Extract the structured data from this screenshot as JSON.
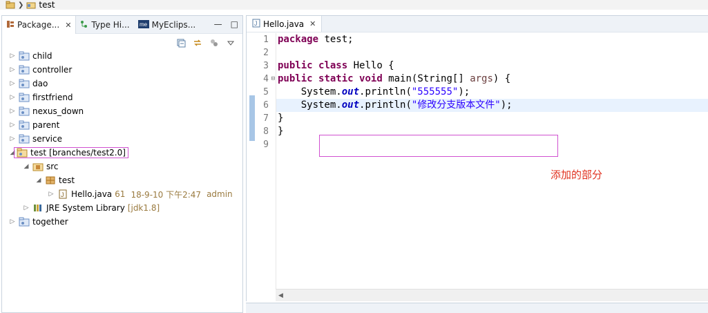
{
  "breadcrumb": {
    "project": "test"
  },
  "left_panel": {
    "tabs": [
      {
        "label": "Package...",
        "active": true,
        "closable": true
      },
      {
        "label": "Type Hi..."
      },
      {
        "label": "MyEclips..."
      }
    ],
    "tree": {
      "projects": [
        {
          "label": "child"
        },
        {
          "label": "controller"
        },
        {
          "label": "dao"
        },
        {
          "label": "firstfriend"
        },
        {
          "label": "nexus_down"
        },
        {
          "label": "parent"
        },
        {
          "label": "service"
        }
      ],
      "test_project": {
        "label": "test",
        "branch": "[branches/test2.0]"
      },
      "src": {
        "label": "src"
      },
      "package": {
        "label": "test"
      },
      "file": {
        "label": "Hello.java",
        "revision": "61",
        "date": "18-9-10 下午2:47",
        "author": "admin"
      },
      "jre": {
        "label": "JRE System Library",
        "version": "[jdk1.8]"
      },
      "together": {
        "label": "together"
      }
    }
  },
  "editor": {
    "tab_label": "Hello.java",
    "line_numbers": [
      "1",
      "2",
      "3",
      "4",
      "5",
      "6",
      "7",
      "8",
      "9"
    ],
    "code": {
      "l1_kw": "package",
      "l1_rest": " test;",
      "l3_kw1": "public",
      "l3_kw2": "class",
      "l3_rest": " Hello {",
      "l4_kw1": "public",
      "l4_kw2": "static",
      "l4_kw3": "void",
      "l4_mid": " main(String[] ",
      "l4_param": "args",
      "l4_end": ") {",
      "l5_pre": "    System.",
      "l5_field": "out",
      "l5_mid": ".println(",
      "l5_str": "\"555555\"",
      "l5_end": ");",
      "l6_pre": "    System.",
      "l6_field": "out",
      "l6_mid": ".println(",
      "l6_str": "\"修改分支版本文件\"",
      "l6_end": ");",
      "l7": "}",
      "l8": "}"
    },
    "annotation": "添加的部分"
  }
}
